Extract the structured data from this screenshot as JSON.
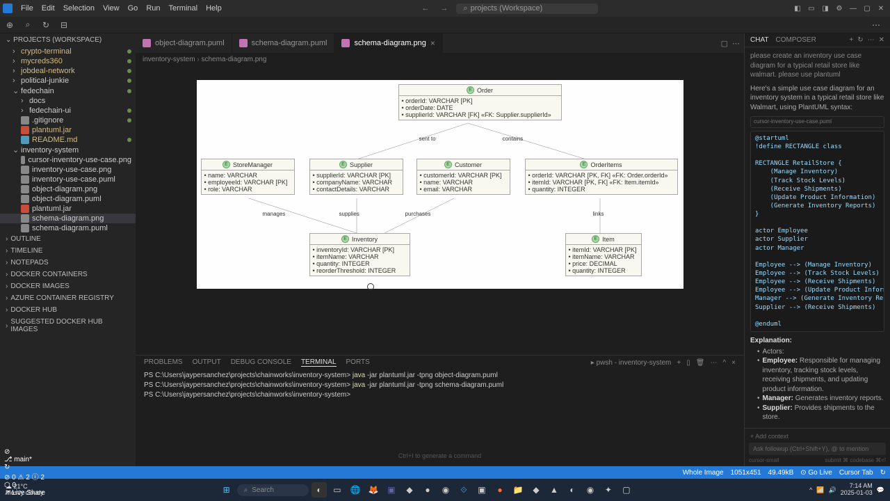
{
  "menubar": [
    "File",
    "Edit",
    "Selection",
    "View",
    "Go",
    "Run",
    "Terminal",
    "Help"
  ],
  "search_placeholder": "projects (Workspace)",
  "sidebar": {
    "header": "PROJECTS (WORKSPACE)",
    "folders": [
      {
        "label": "crypto-terminal",
        "mod": true,
        "dot": true
      },
      {
        "label": "mycreds360",
        "mod": true,
        "dot": true
      },
      {
        "label": "jobdeal-network",
        "mod": true,
        "dot": true
      },
      {
        "label": "political-junkie",
        "mod": false,
        "dot": true
      }
    ],
    "open_folder": "fedechain",
    "open_children": [
      {
        "label": "docs",
        "folder": true
      },
      {
        "label": "fedechain-ui",
        "folder": true,
        "dot": true
      },
      {
        "label": ".gitignore",
        "dot": true
      },
      {
        "label": "plantuml.jar",
        "mod": true,
        "icon": "#c74e39"
      },
      {
        "label": "README.md",
        "mod": true,
        "dot": true,
        "icon": "#519aba"
      }
    ],
    "open_folder2": "inventory-system",
    "open_children2": [
      {
        "label": "cursor-inventory-use-case.png"
      },
      {
        "label": "inventory-use-case.png"
      },
      {
        "label": "inventory-use-case.puml"
      },
      {
        "label": "object-diagram.png"
      },
      {
        "label": "object-diagram.puml"
      },
      {
        "label": "plantuml.jar",
        "icon": "#c74e39"
      },
      {
        "label": "schema-diagram.png",
        "sel": true
      },
      {
        "label": "schema-diagram.puml"
      }
    ],
    "outline": [
      "OUTLINE",
      "TIMELINE",
      "NOTEPADS",
      "DOCKER CONTAINERS",
      "DOCKER IMAGES",
      "AZURE CONTAINER REGISTRY",
      "DOCKER HUB",
      "SUGGESTED DOCKER HUB IMAGES"
    ]
  },
  "tabs": [
    {
      "label": "object-diagram.puml"
    },
    {
      "label": "schema-diagram.puml"
    },
    {
      "label": "schema-diagram.png",
      "active": true
    }
  ],
  "breadcrumb": [
    "inventory-system",
    "schema-diagram.png"
  ],
  "entities": {
    "order": {
      "name": "Order",
      "fields": [
        "orderId: VARCHAR [PK]",
        "orderDate: DATE",
        "supplierId: VARCHAR [FK] «FK: Supplier.supplierId»"
      ]
    },
    "storemgr": {
      "name": "StoreManager",
      "fields": [
        "name: VARCHAR",
        "employeeId: VARCHAR [PK]",
        "role: VARCHAR"
      ]
    },
    "supplier": {
      "name": "Supplier",
      "fields": [
        "supplierId: VARCHAR [PK]",
        "companyName: VARCHAR",
        "contactDetails: VARCHAR"
      ]
    },
    "customer": {
      "name": "Customer",
      "fields": [
        "customerId: VARCHAR [PK]",
        "name: VARCHAR",
        "email: VARCHAR"
      ]
    },
    "orderitems": {
      "name": "OrderItems",
      "fields": [
        "orderId: VARCHAR [PK, FK] «FK: Order.orderId»",
        "itemId: VARCHAR [PK, FK] «FK: Item.itemId»",
        "quantity: INTEGER"
      ]
    },
    "inventory": {
      "name": "Inventory",
      "fields": [
        "inventoryId: VARCHAR [PK]",
        "itemName: VARCHAR",
        "quantity: INTEGER",
        "reorderThreshold: INTEGER"
      ]
    },
    "item": {
      "name": "Item",
      "fields": [
        "itemId: VARCHAR [PK]",
        "itemName: VARCHAR",
        "price: DECIMAL",
        "quantity: INTEGER"
      ]
    }
  },
  "rels": {
    "sent_to": "sent to",
    "contains": "contains",
    "manages": "manages",
    "supplies": "supplies",
    "purchases": "purchases",
    "links": "links"
  },
  "panel": {
    "tabs": [
      "PROBLEMS",
      "OUTPUT",
      "DEBUG CONSOLE",
      "TERMINAL",
      "PORTS"
    ],
    "active": "TERMINAL",
    "shell_label": "pwsh - inventory-system",
    "lines": [
      {
        "prompt": "PS C:\\Users\\jaypersanchez\\projects\\chainworks\\inventory-system>",
        "cmd": "java",
        "args": "-jar plantuml.jar -tpng object-diagram.puml"
      },
      {
        "prompt": "PS C:\\Users\\jaypersanchez\\projects\\chainworks\\inventory-system>",
        "cmd": "java",
        "args": "-jar plantuml.jar -tpng schema-diagram.puml"
      },
      {
        "prompt": "PS C:\\Users\\jaypersanchez\\projects\\chainworks\\inventory-system>",
        "cmd": "",
        "args": ""
      }
    ],
    "hint": "Ctrl+I to generate a command"
  },
  "chat": {
    "tabs": [
      "CHAT",
      "COMPOSER"
    ],
    "user_msg": "please create an inventory use case diagram for a typical retail store like walmart.  please use plantuml",
    "reply_intro": "Here's a simple use case diagram for an inventory system in a typical retail store like Walmart, using PlantUML syntax:",
    "code_title": "cursor-inventory-use-case.puml",
    "code": "@startuml\n!define RECTANGLE class\n\nRECTANGLE RetailStore {\n    (Manage Inventory)\n    (Track Stock Levels)\n    (Receive Shipments)\n    (Update Product Information)\n    (Generate Inventory Reports)\n}\n\nactor Employee\nactor Supplier\nactor Manager\n\nEmployee --> (Manage Inventory)\nEmployee --> (Track Stock Levels)\nEmployee --> (Receive Shipments)\nEmployee --> (Update Product Information\nManager --> (Generate Inventory Reports)\nSupplier --> (Receive Shipments)\n\n@enduml",
    "explanation_hdr": "Explanation:",
    "actors_hdr": "Actors:",
    "bullets": [
      {
        "b": "Employee:",
        "t": " Responsible for managing inventory, tracking stock levels, receiving shipments, and updating product information."
      },
      {
        "b": "Manager:",
        "t": " Generates inventory reports."
      },
      {
        "b": "Supplier:",
        "t": " Provides shipments to the store."
      }
    ],
    "add_context": "+ Add context",
    "input_placeholder": "Ask followup (Ctrl+Shift+Y), @ to mention",
    "model": "cursor-small",
    "submit": "submit ⌘  codebase ⌘⏎"
  },
  "status": {
    "left": [
      "⊘",
      "⎇ main*",
      "↻",
      "⊘ 0 ⚠ 2 ⓘ 2",
      "⬡ 0",
      "↗ Live Share"
    ],
    "right": [
      "Whole Image",
      "1051x451",
      "49.49kB",
      "⊙ Go Live",
      "Cursor Tab",
      "↻"
    ]
  },
  "taskbar": {
    "weather_temp": "21°C",
    "weather_cond": "Mostly cloudy",
    "search": "Search",
    "time": "7:14 AM",
    "date": "2025-01-03"
  }
}
